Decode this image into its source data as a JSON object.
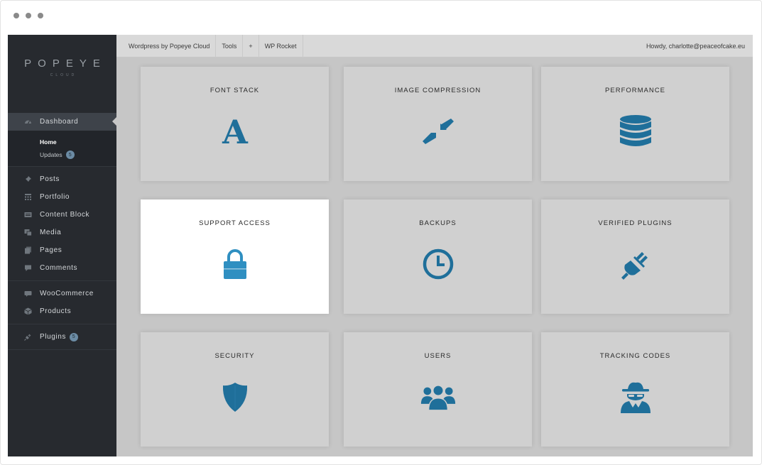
{
  "colors": {
    "sidebar_bg": "#272a2f",
    "accent": "#1f6f9a",
    "accent_active": "#2f8fc1",
    "tile_bg": "#d0d0d0"
  },
  "logo": {
    "main": "POPEYE",
    "sub": "CLOUD"
  },
  "sidebar": {
    "dashboard": {
      "label": "Dashboard",
      "icon": "dashboard-icon"
    },
    "sub_items": [
      {
        "label": "Home"
      },
      {
        "label": "Updates",
        "badge": "5"
      }
    ],
    "group1": [
      {
        "label": "Posts",
        "icon": "pin-icon"
      },
      {
        "label": "Portfolio",
        "icon": "grid-icon"
      },
      {
        "label": "Content Block",
        "icon": "block-icon"
      },
      {
        "label": "Media",
        "icon": "media-icon"
      },
      {
        "label": "Pages",
        "icon": "pages-icon"
      },
      {
        "label": "Comments",
        "icon": "comment-icon"
      }
    ],
    "group2": [
      {
        "label": "WooCommerce",
        "icon": "woo-icon"
      },
      {
        "label": "Products",
        "icon": "box-icon"
      }
    ],
    "plugins": {
      "label": "Plugins",
      "badge": "5",
      "icon": "plug-icon"
    }
  },
  "topbar": {
    "items": [
      "Wordpress by Popeye Cloud",
      "Tools",
      "+",
      "WP Rocket"
    ],
    "howdy": "Howdy, charlotte@peaceofcake.eu"
  },
  "tiles": [
    {
      "title": "FONT STACK",
      "icon": "font-icon"
    },
    {
      "title": "IMAGE COMPRESSION",
      "icon": "compress-icon"
    },
    {
      "title": "PERFORMANCE",
      "icon": "database-icon"
    },
    {
      "title": "SUPPORT ACCESS",
      "icon": "lock-icon"
    },
    {
      "title": "BACKUPS",
      "icon": "clock-icon"
    },
    {
      "title": "VERIFIED PLUGINS",
      "icon": "plug-icon"
    },
    {
      "title": "SECURITY",
      "icon": "shield-icon"
    },
    {
      "title": "USERS",
      "icon": "users-icon"
    },
    {
      "title": "TRACKING CODES",
      "icon": "spy-icon"
    }
  ]
}
